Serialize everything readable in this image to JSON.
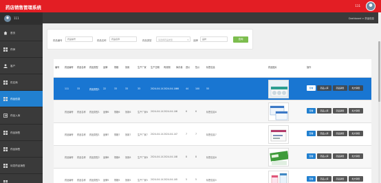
{
  "header": {
    "title": "药店销售管理系统",
    "user": "111"
  },
  "sidebar": {
    "username": "111",
    "items": [
      {
        "label": "首页",
        "icon": "home-icon"
      },
      {
        "label": "药师",
        "icon": "grid-icon"
      },
      {
        "label": "客户",
        "icon": "user-icon"
      },
      {
        "label": "供应商",
        "icon": "grid-icon"
      },
      {
        "label": "药品信息",
        "icon": "grid-icon",
        "active": true
      },
      {
        "label": "药品入库",
        "icon": "import-icon"
      },
      {
        "label": "药品销售",
        "icon": "grid-icon"
      },
      {
        "label": "药品销售",
        "icon": "grid-icon"
      },
      {
        "label": "待发药品销售",
        "icon": "grid-icon"
      },
      {
        "label": "",
        "icon": "grid-icon"
      }
    ]
  },
  "breadcrumb": "Dashboard > 药品信息",
  "search": {
    "fields": [
      {
        "label": "药品编号",
        "placeholder": "药品编号"
      },
      {
        "label": "药品名称",
        "placeholder": "药品名称"
      },
      {
        "label": "药品类型",
        "placeholder": "请选择药品类型"
      },
      {
        "label": "品牌",
        "placeholder": "品牌"
      }
    ],
    "button": "查询"
  },
  "table": {
    "columns": [
      "编号",
      "药品编号",
      "药品名称",
      "药品类型",
      "品牌",
      "规格",
      "效用",
      "生产厂家",
      "生产日期",
      "有效期",
      "库存量",
      "进价",
      "售价",
      "标签信息",
      "药品图片",
      "操作"
    ],
    "rows": [
      {
        "selected": true,
        "cells": [
          "",
          "111",
          "33",
          "药品类型1",
          "22",
          "33",
          "33",
          "33",
          "2024-04-14",
          "2024-04-14",
          "66",
          "44",
          "100",
          "55"
        ]
      },
      {
        "cells": [
          "",
          "药品编号",
          "药品名称",
          "药品类型1",
          "品牌6",
          "规格6",
          "效用6",
          "生产厂家6",
          "2024-04-14",
          "2024-04-14",
          "6",
          "6",
          "6",
          "标签信息6"
        ]
      },
      {
        "cells": [
          "",
          "药品编号",
          "药品名称",
          "药品类型1",
          "品牌7",
          "规格7",
          "效用7",
          "生产厂家7",
          "2024-04-14",
          "2024-04-14",
          "7",
          "7",
          "7",
          "标签信息7"
        ]
      },
      {
        "cells": [
          "",
          "药品编号",
          "药品名称",
          "药品类型2",
          "品牌8",
          "规格8",
          "效用8",
          "生产厂家8",
          "2024-04-14",
          "2024-04-14",
          "8",
          "8",
          "8",
          "标签信息8"
        ]
      },
      {
        "cells": [
          "",
          "药品编号",
          "药品名称",
          "药品类型3",
          "品牌5",
          "规格5",
          "效用5",
          "生产厂家5",
          "2024-04-14",
          "2024-04-14",
          "5",
          "5",
          "5",
          "标签信息5"
        ]
      }
    ],
    "actions": [
      "查看",
      "药品入库",
      "药品销售",
      "处方销售"
    ]
  },
  "colors": {
    "header": "#e31e24",
    "sidebar": "#3a3a3a",
    "accent": "#2180d0",
    "search_button": "#7cbd4e"
  }
}
